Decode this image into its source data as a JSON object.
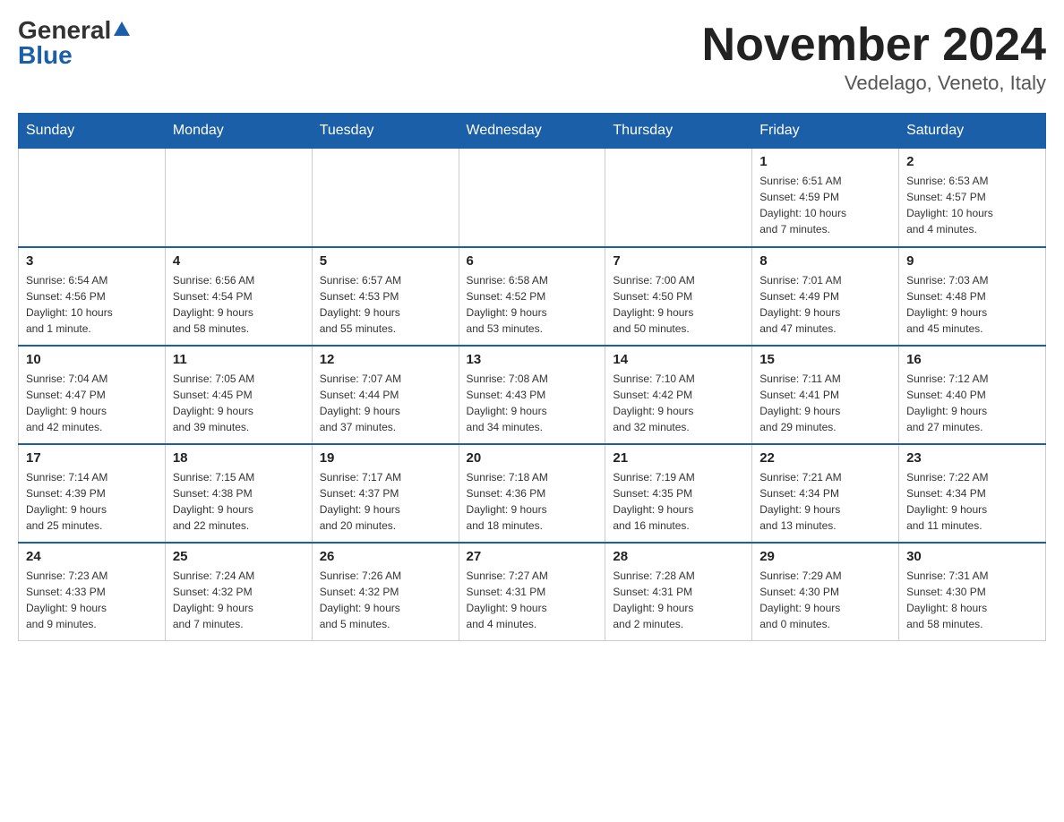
{
  "header": {
    "logo_general": "General",
    "logo_blue": "Blue",
    "month_title": "November 2024",
    "location": "Vedelago, Veneto, Italy"
  },
  "weekdays": [
    "Sunday",
    "Monday",
    "Tuesday",
    "Wednesday",
    "Thursday",
    "Friday",
    "Saturday"
  ],
  "weeks": [
    {
      "days": [
        {
          "number": "",
          "info": ""
        },
        {
          "number": "",
          "info": ""
        },
        {
          "number": "",
          "info": ""
        },
        {
          "number": "",
          "info": ""
        },
        {
          "number": "",
          "info": ""
        },
        {
          "number": "1",
          "info": "Sunrise: 6:51 AM\nSunset: 4:59 PM\nDaylight: 10 hours\nand 7 minutes."
        },
        {
          "number": "2",
          "info": "Sunrise: 6:53 AM\nSunset: 4:57 PM\nDaylight: 10 hours\nand 4 minutes."
        }
      ]
    },
    {
      "days": [
        {
          "number": "3",
          "info": "Sunrise: 6:54 AM\nSunset: 4:56 PM\nDaylight: 10 hours\nand 1 minute."
        },
        {
          "number": "4",
          "info": "Sunrise: 6:56 AM\nSunset: 4:54 PM\nDaylight: 9 hours\nand 58 minutes."
        },
        {
          "number": "5",
          "info": "Sunrise: 6:57 AM\nSunset: 4:53 PM\nDaylight: 9 hours\nand 55 minutes."
        },
        {
          "number": "6",
          "info": "Sunrise: 6:58 AM\nSunset: 4:52 PM\nDaylight: 9 hours\nand 53 minutes."
        },
        {
          "number": "7",
          "info": "Sunrise: 7:00 AM\nSunset: 4:50 PM\nDaylight: 9 hours\nand 50 minutes."
        },
        {
          "number": "8",
          "info": "Sunrise: 7:01 AM\nSunset: 4:49 PM\nDaylight: 9 hours\nand 47 minutes."
        },
        {
          "number": "9",
          "info": "Sunrise: 7:03 AM\nSunset: 4:48 PM\nDaylight: 9 hours\nand 45 minutes."
        }
      ]
    },
    {
      "days": [
        {
          "number": "10",
          "info": "Sunrise: 7:04 AM\nSunset: 4:47 PM\nDaylight: 9 hours\nand 42 minutes."
        },
        {
          "number": "11",
          "info": "Sunrise: 7:05 AM\nSunset: 4:45 PM\nDaylight: 9 hours\nand 39 minutes."
        },
        {
          "number": "12",
          "info": "Sunrise: 7:07 AM\nSunset: 4:44 PM\nDaylight: 9 hours\nand 37 minutes."
        },
        {
          "number": "13",
          "info": "Sunrise: 7:08 AM\nSunset: 4:43 PM\nDaylight: 9 hours\nand 34 minutes."
        },
        {
          "number": "14",
          "info": "Sunrise: 7:10 AM\nSunset: 4:42 PM\nDaylight: 9 hours\nand 32 minutes."
        },
        {
          "number": "15",
          "info": "Sunrise: 7:11 AM\nSunset: 4:41 PM\nDaylight: 9 hours\nand 29 minutes."
        },
        {
          "number": "16",
          "info": "Sunrise: 7:12 AM\nSunset: 4:40 PM\nDaylight: 9 hours\nand 27 minutes."
        }
      ]
    },
    {
      "days": [
        {
          "number": "17",
          "info": "Sunrise: 7:14 AM\nSunset: 4:39 PM\nDaylight: 9 hours\nand 25 minutes."
        },
        {
          "number": "18",
          "info": "Sunrise: 7:15 AM\nSunset: 4:38 PM\nDaylight: 9 hours\nand 22 minutes."
        },
        {
          "number": "19",
          "info": "Sunrise: 7:17 AM\nSunset: 4:37 PM\nDaylight: 9 hours\nand 20 minutes."
        },
        {
          "number": "20",
          "info": "Sunrise: 7:18 AM\nSunset: 4:36 PM\nDaylight: 9 hours\nand 18 minutes."
        },
        {
          "number": "21",
          "info": "Sunrise: 7:19 AM\nSunset: 4:35 PM\nDaylight: 9 hours\nand 16 minutes."
        },
        {
          "number": "22",
          "info": "Sunrise: 7:21 AM\nSunset: 4:34 PM\nDaylight: 9 hours\nand 13 minutes."
        },
        {
          "number": "23",
          "info": "Sunrise: 7:22 AM\nSunset: 4:34 PM\nDaylight: 9 hours\nand 11 minutes."
        }
      ]
    },
    {
      "days": [
        {
          "number": "24",
          "info": "Sunrise: 7:23 AM\nSunset: 4:33 PM\nDaylight: 9 hours\nand 9 minutes."
        },
        {
          "number": "25",
          "info": "Sunrise: 7:24 AM\nSunset: 4:32 PM\nDaylight: 9 hours\nand 7 minutes."
        },
        {
          "number": "26",
          "info": "Sunrise: 7:26 AM\nSunset: 4:32 PM\nDaylight: 9 hours\nand 5 minutes."
        },
        {
          "number": "27",
          "info": "Sunrise: 7:27 AM\nSunset: 4:31 PM\nDaylight: 9 hours\nand 4 minutes."
        },
        {
          "number": "28",
          "info": "Sunrise: 7:28 AM\nSunset: 4:31 PM\nDaylight: 9 hours\nand 2 minutes."
        },
        {
          "number": "29",
          "info": "Sunrise: 7:29 AM\nSunset: 4:30 PM\nDaylight: 9 hours\nand 0 minutes."
        },
        {
          "number": "30",
          "info": "Sunrise: 7:31 AM\nSunset: 4:30 PM\nDaylight: 8 hours\nand 58 minutes."
        }
      ]
    }
  ]
}
